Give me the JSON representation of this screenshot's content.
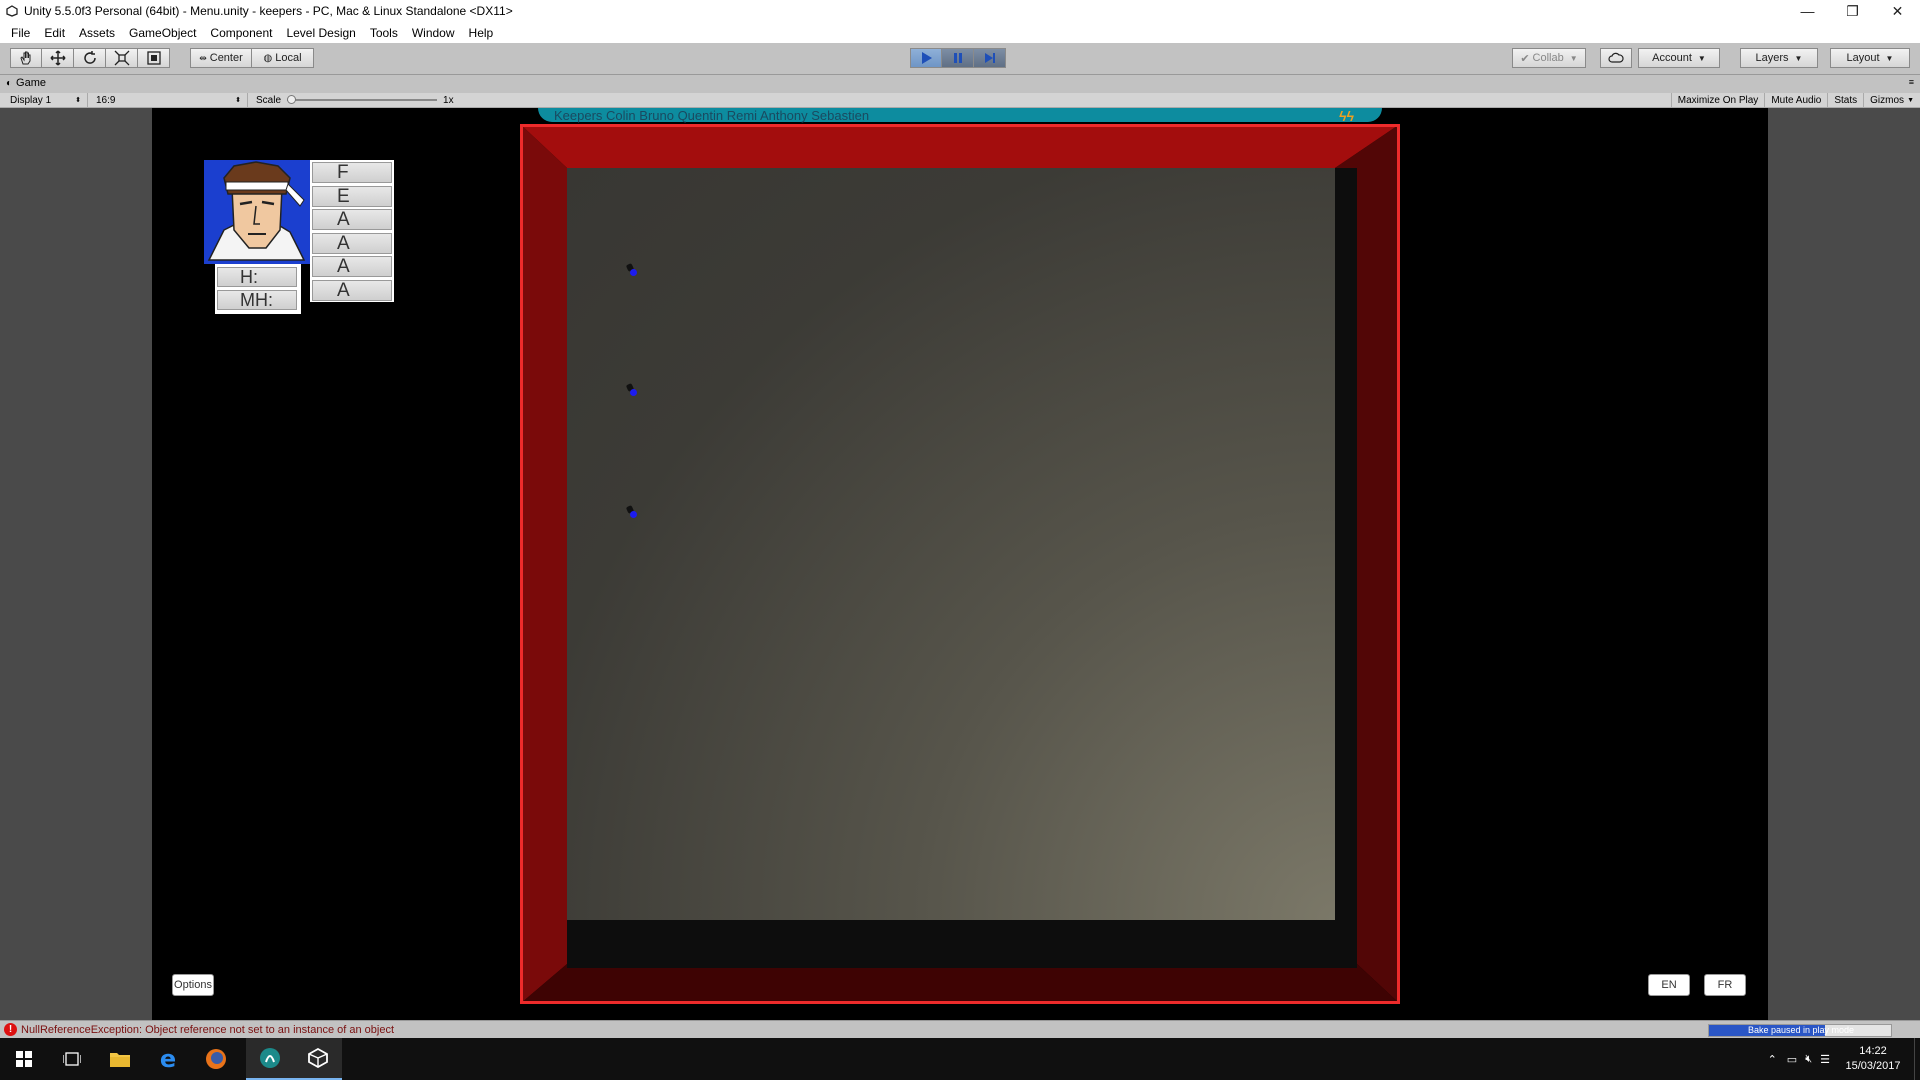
{
  "window": {
    "title": "Unity 5.5.0f3 Personal (64bit) - Menu.unity - keepers - PC, Mac & Linux Standalone <DX11>",
    "controls": [
      "—",
      "❐",
      "✕"
    ]
  },
  "menu": [
    "File",
    "Edit",
    "Assets",
    "GameObject",
    "Component",
    "Level Design",
    "Tools",
    "Window",
    "Help"
  ],
  "toolbar": {
    "pivot_label": "Center",
    "space_label": "Local",
    "collab_label": "Collab",
    "account_label": "Account",
    "layers_label": "Layers",
    "layout_label": "Layout"
  },
  "game_panel": {
    "tab_label": "Game",
    "display": "Display 1",
    "aspect": "16:9",
    "scale_label": "Scale",
    "scale_value": "1x",
    "maximize": "Maximize On Play",
    "mute": "Mute Audio",
    "stats": "Stats",
    "gizmos": "Gizmos"
  },
  "game": {
    "top_strip_text": "Keepers   Colin  Bruno  Quentin  Remi  Anthony  Sebastien",
    "top_strip_logo": "ϟϟ",
    "stats": [
      "F",
      "E",
      "A",
      "A",
      "A",
      "A"
    ],
    "health_label": "H:",
    "max_health_label": "MH:",
    "options_label": "Options",
    "lang_en": "EN",
    "lang_fr": "FR"
  },
  "status": {
    "error_text": "NullReferenceException: Object reference not set to an instance of an object",
    "bake_text": "Bake paused in play mode",
    "bake_progress": 0.64
  },
  "taskbar": {
    "time": "14:22",
    "date": "15/03/2017"
  },
  "colors": {
    "frame_red": "#a30d0d",
    "frame_border": "#ee2b2b",
    "keeper_blue": "#1c1cf0",
    "play_blue": "#6e95c6"
  }
}
